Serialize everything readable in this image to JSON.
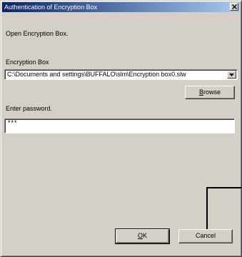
{
  "window": {
    "title": "Authentication of Encryption Box"
  },
  "dialog": {
    "intro_text": "Open Encryption Box.",
    "box_label": "Encryption Box",
    "box_path": "C:\\Documents and settings\\BUFFALO\\slm\\Encryption box0.slw",
    "browse_mnemonic": "B",
    "browse_rest": "rowse",
    "password_label": "Enter password.",
    "password_value": "***",
    "ok_mnemonic": "O",
    "ok_rest": "K",
    "cancel_label": "Cancel"
  },
  "icons": {
    "close": "close-icon",
    "dropdown": "chevron-down-icon"
  },
  "colors": {
    "titlebar_start": "#0a246a",
    "titlebar_end": "#a6caf0",
    "face": "#d4d0c8"
  }
}
